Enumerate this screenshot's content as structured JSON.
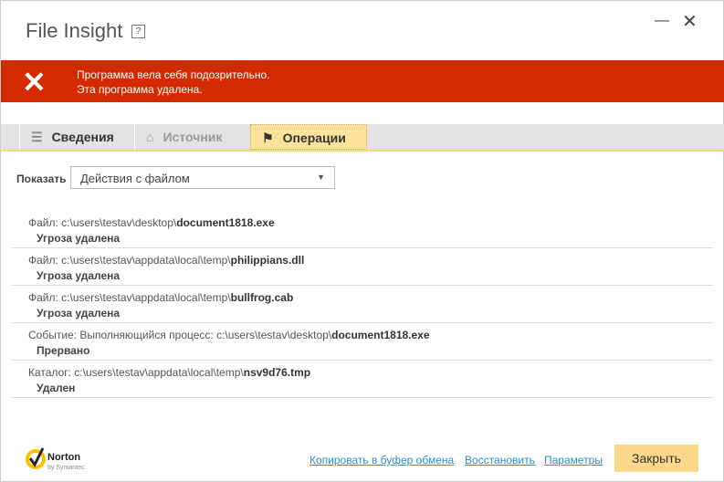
{
  "title": "File Insight",
  "help": "?",
  "banner": {
    "line1": "Программа вела себя подозрительно.",
    "line2": "Эта программа удалена."
  },
  "tabs": [
    {
      "label": "Сведения"
    },
    {
      "label": "Источник"
    },
    {
      "label": "Операции"
    }
  ],
  "filter": {
    "label": "Показать",
    "value": "Действия с файлом"
  },
  "items": [
    {
      "prefix": "Файл: c:\\users\\testav\\desktop\\",
      "name": "document1818.exe",
      "status": "Угроза удалена"
    },
    {
      "prefix": "Файл: c:\\users\\testav\\appdata\\local\\temp\\",
      "name": "philippians.dll",
      "status": "Угроза удалена"
    },
    {
      "prefix": "Файл: c:\\users\\testav\\appdata\\local\\temp\\",
      "name": "bullfrog.cab",
      "status": "Угроза удалена"
    },
    {
      "prefix": "Событие: Выполняющийся процесс: c:\\users\\testav\\desktop\\",
      "name": "document1818.exe",
      "status": "Прервано"
    },
    {
      "prefix": "Каталог: c:\\users\\testav\\appdata\\local\\temp\\",
      "name": "nsv9d76.tmp",
      "status": "Удален"
    }
  ],
  "footer": {
    "logo": "Norton",
    "logo_sub": "by Symantec",
    "copy": "Копировать в буфер обмена",
    "restore": "Восстановить",
    "settings": "Параметры",
    "close": "Закрыть"
  }
}
